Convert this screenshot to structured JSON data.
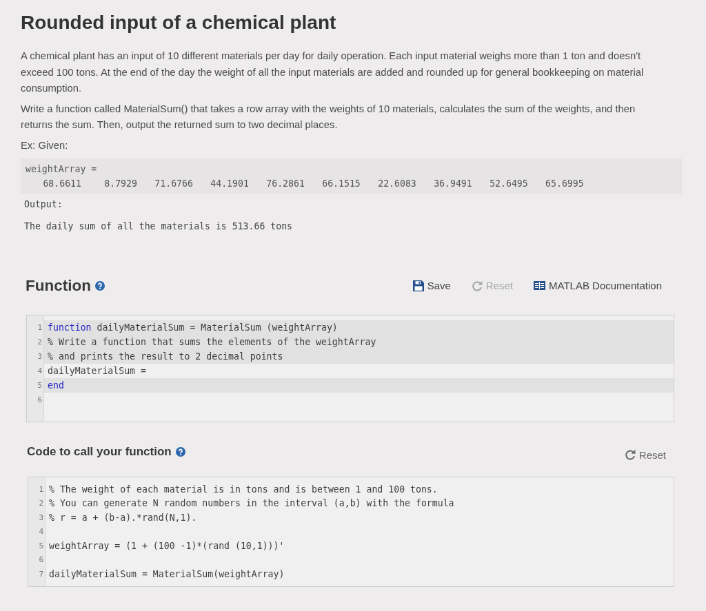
{
  "title": "Rounded input of a chemical plant",
  "description": {
    "paragraphs": [
      "A chemical plant has an input of 10 different materials per day for daily operation. Each input material weighs more than 1 ton and doesn't exceed 100 tons. At the end of the day the weight of all the input materials are added and rounded up for general bookkeeping on material consumption.",
      "Write a function called MaterialSum() that takes a row array with the weights of 10 materials, calculates the sum of the weights, and then returns the sum. Then, output the returned sum to two decimal places."
    ],
    "example_label": "Ex: Given:"
  },
  "example": {
    "variable": "weightArray =",
    "values": [
      "68.6611",
      "8.7929",
      "71.6766",
      "44.1901",
      "76.2861",
      "66.1515",
      "22.6083",
      "36.9491",
      "52.6495",
      "65.6995"
    ],
    "output_label": "Output:",
    "output_text": "The daily sum of all the materials is 513.66 tons"
  },
  "function_section": {
    "heading": "Function",
    "buttons": [
      {
        "kind": "save",
        "label": "Save",
        "disabled": false
      },
      {
        "kind": "reset",
        "label": "Reset",
        "disabled": true
      },
      {
        "kind": "docs",
        "label": "MATLAB Documentation",
        "disabled": false
      }
    ],
    "editor": {
      "lines": [
        {
          "number": "1",
          "locked": true,
          "tokens": [
            {
              "kind": "keyword",
              "text": "function"
            },
            {
              "kind": "code",
              "text": " dailyMaterialSum = MaterialSum (weightArray)"
            }
          ]
        },
        {
          "number": "2",
          "locked": true,
          "tokens": [
            {
              "kind": "code",
              "text": "% Write a function that sums the elements of the weightArray"
            }
          ]
        },
        {
          "number": "3",
          "locked": true,
          "tokens": [
            {
              "kind": "code",
              "text": "% and prints the result to 2 decimal points"
            }
          ]
        },
        {
          "number": "4",
          "locked": false,
          "tokens": [
            {
              "kind": "code",
              "text": "dailyMaterialSum ="
            }
          ]
        },
        {
          "number": "5",
          "locked": true,
          "tokens": [
            {
              "kind": "keyword",
              "text": "end"
            }
          ]
        },
        {
          "number": "6",
          "locked": false
        }
      ]
    }
  },
  "call_section": {
    "heading": "Code to call your function",
    "buttons": [
      {
        "kind": "reset",
        "label": "Reset",
        "disabled": false
      }
    ],
    "editor": {
      "lines": [
        {
          "number": "1",
          "locked": false,
          "tokens": [
            {
              "kind": "code",
              "text": "% The weight of each material is in tons and is between 1 and 100 tons."
            }
          ]
        },
        {
          "number": "2",
          "locked": false,
          "tokens": [
            {
              "kind": "code",
              "text": "% You can generate N random numbers in the interval (a,b) with the formula"
            }
          ]
        },
        {
          "number": "3",
          "locked": false,
          "tokens": [
            {
              "kind": "code",
              "text": "% r = a + (b-a).*rand(N,1)."
            }
          ]
        },
        {
          "number": "4",
          "locked": false
        },
        {
          "number": "5",
          "locked": false,
          "tokens": [
            {
              "kind": "code",
              "text": "weightArray = (1 + (100 -1)*(rand (10,1)))'"
            }
          ]
        },
        {
          "number": "6",
          "locked": false
        },
        {
          "number": "7",
          "locked": false,
          "tokens": [
            {
              "kind": "code",
              "text": "dailyMaterialSum = MaterialSum(weightArray)"
            }
          ]
        }
      ]
    }
  }
}
